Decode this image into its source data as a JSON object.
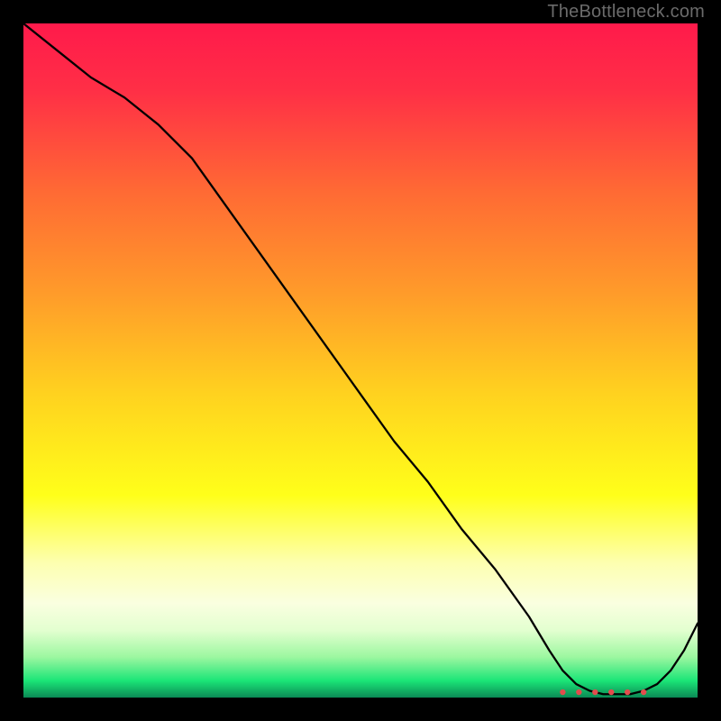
{
  "watermark": "TheBottleneck.com",
  "chart_data": {
    "type": "line",
    "title": "",
    "xlabel": "",
    "ylabel": "",
    "xlim": [
      0,
      100
    ],
    "ylim": [
      0,
      100
    ],
    "gradient_stops": [
      {
        "offset": 0.0,
        "color": "#ff1a4b"
      },
      {
        "offset": 0.1,
        "color": "#ff2f46"
      },
      {
        "offset": 0.25,
        "color": "#ff6a34"
      },
      {
        "offset": 0.4,
        "color": "#ff9b2a"
      },
      {
        "offset": 0.55,
        "color": "#ffd21f"
      },
      {
        "offset": 0.7,
        "color": "#ffff1a"
      },
      {
        "offset": 0.8,
        "color": "#fdffb0"
      },
      {
        "offset": 0.86,
        "color": "#faffe0"
      },
      {
        "offset": 0.9,
        "color": "#e3ffd0"
      },
      {
        "offset": 0.94,
        "color": "#9cf7a0"
      },
      {
        "offset": 0.975,
        "color": "#1be577"
      },
      {
        "offset": 1.0,
        "color": "#0b8a55"
      }
    ],
    "series": [
      {
        "name": "bottleneck-curve",
        "x": [
          0,
          5,
          10,
          15,
          20,
          25,
          30,
          35,
          40,
          45,
          50,
          55,
          60,
          65,
          70,
          75,
          78,
          80,
          82,
          84,
          86,
          88,
          90,
          92,
          94,
          96,
          98,
          100
        ],
        "y": [
          100,
          96,
          92,
          89,
          85,
          80,
          73,
          66,
          59,
          52,
          45,
          38,
          32,
          25,
          19,
          12,
          7,
          4,
          2,
          1,
          0.5,
          0.5,
          0.5,
          1,
          2,
          4,
          7,
          11
        ]
      }
    ],
    "flat_zone": {
      "x_start": 80,
      "x_end": 92,
      "dot_count": 6,
      "y": 0.8
    },
    "line_color": "#000000",
    "dot_color": "#e24d4d"
  }
}
